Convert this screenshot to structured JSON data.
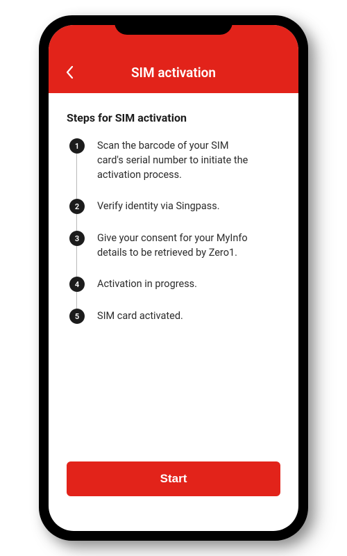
{
  "header": {
    "title": "SIM activation"
  },
  "content": {
    "steps_title": "Steps for SIM activation",
    "steps": [
      {
        "num": "1",
        "text": "Scan the barcode of your SIM card's serial number to initiate the activation process."
      },
      {
        "num": "2",
        "text": "Verify identity via Singpass."
      },
      {
        "num": "3",
        "text": "Give your consent for your MyInfo details to be retrieved by Zero1."
      },
      {
        "num": "4",
        "text": "Activation in progress."
      },
      {
        "num": "5",
        "text": "SIM card activated."
      }
    ],
    "start_label": "Start"
  },
  "colors": {
    "brand_red": "#e2231a",
    "text_dark": "#1c1c1c"
  }
}
